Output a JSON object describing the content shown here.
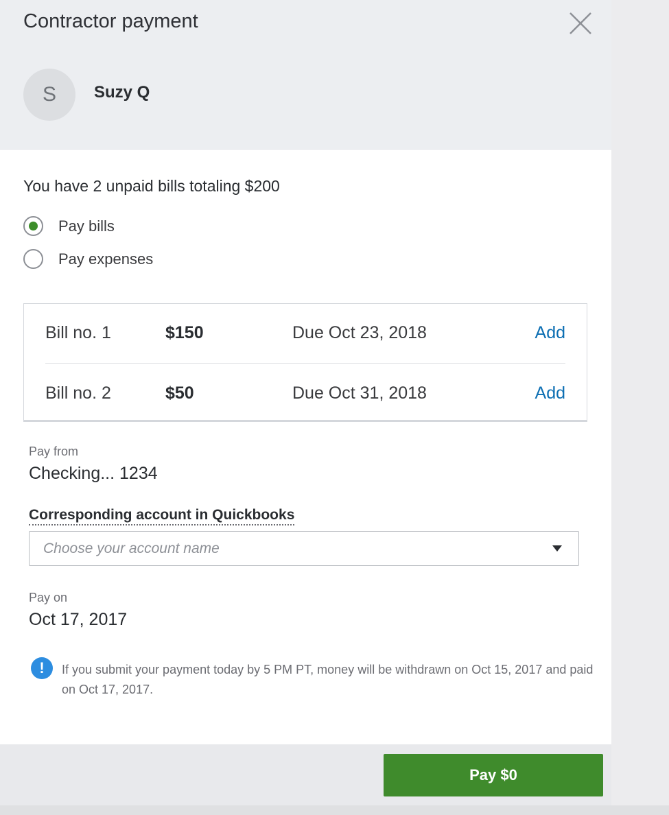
{
  "header": {
    "title": "Contractor payment",
    "contractor": {
      "initial": "S",
      "name": "Suzy Q"
    }
  },
  "summary": "You have 2 unpaid bills totaling $200",
  "payment_type": {
    "options": [
      {
        "label": "Pay bills",
        "selected": true
      },
      {
        "label": "Pay expenses",
        "selected": false
      }
    ]
  },
  "bills": [
    {
      "name": "Bill no. 1",
      "amount": "$150",
      "due": "Due Oct 23, 2018",
      "action": "Add"
    },
    {
      "name": "Bill no. 2",
      "amount": "$50",
      "due": "Due Oct 31, 2018",
      "action": "Add"
    }
  ],
  "pay_from": {
    "label": "Pay from",
    "value": "Checking... 1234"
  },
  "corresponding_account": {
    "label": "Corresponding account in Quickbooks",
    "placeholder": "Choose your account name"
  },
  "pay_on": {
    "label": "Pay on",
    "value": "Oct 17, 2017"
  },
  "info": {
    "icon": "exclamation-info-icon",
    "text": "If you submit your payment today by 5 PM PT, money will be withdrawn on Oct 15, 2017 and paid on Oct 17, 2017."
  },
  "footer": {
    "pay_button_label": "Pay $0"
  },
  "colors": {
    "accent_green": "#3f8b2c",
    "link_blue": "#0d6fb3",
    "info_blue": "#2d8de0"
  }
}
